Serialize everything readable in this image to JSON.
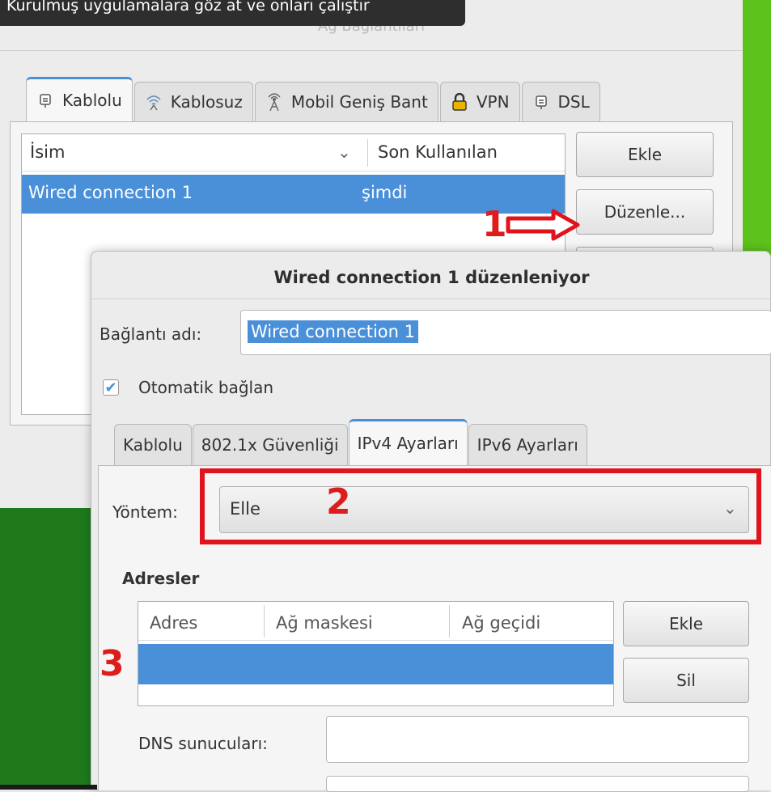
{
  "network_window": {
    "tooltip_text": "Kurulmuş uygulamalara göz at ve onları çalıştır",
    "title": "Ağ Bağlantıları",
    "tabs": [
      {
        "label": "Kablolu",
        "icon": "wired-icon"
      },
      {
        "label": "Kablosuz",
        "icon": "wireless-icon"
      },
      {
        "label": "Mobil Geniş Bant",
        "icon": "mobile-broadband-icon"
      },
      {
        "label": "VPN",
        "icon": "lock-icon"
      },
      {
        "label": "DSL",
        "icon": "dsl-icon"
      }
    ],
    "list": {
      "col_name": "İsim",
      "col_last_used": "Son Kullanılan",
      "rows": [
        {
          "name": "Wired connection 1",
          "last_used": "şimdi"
        }
      ]
    },
    "buttons": {
      "add": "Ekle",
      "edit": "Düzenle..."
    }
  },
  "dialog": {
    "title": "Wired connection 1 düzenleniyor",
    "name_label": "Bağlantı adı:",
    "name_value": "Wired connection 1",
    "autoconnect_label": "Otomatik bağlan",
    "autoconnect_checked": true,
    "tabs": [
      "Kablolu",
      "802.1x Güvenliği",
      "IPv4 Ayarları",
      "IPv6 Ayarları"
    ],
    "active_tab": "IPv4 Ayarları",
    "method_label": "Yöntem:",
    "method_value": "Elle",
    "addresses_heading": "Adresler",
    "addr_cols": {
      "address": "Adres",
      "netmask": "Ağ maskesi",
      "gateway": "Ağ geçidi"
    },
    "addr_buttons": {
      "add": "Ekle",
      "delete": "Sil"
    },
    "dns_label": "DNS sunucuları:"
  },
  "annotations": {
    "step1": "1",
    "step2": "2",
    "step3": "3",
    "color": "#e0141c"
  },
  "colors": {
    "selection": "#4a90d9",
    "desktop_green": "#5cc21c"
  }
}
